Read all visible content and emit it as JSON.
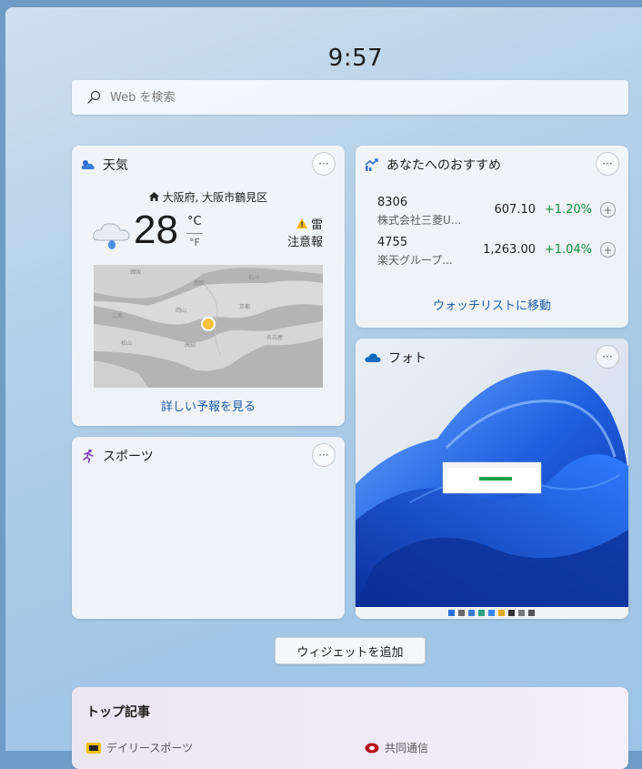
{
  "clock": {
    "time": "9:57"
  },
  "search": {
    "placeholder": "Web を検索",
    "icon": "search-icon"
  },
  "weather": {
    "title": "天気",
    "more": "···",
    "location": "大阪府, 大阪市鶴見区",
    "temperature": "28",
    "unit_c": "°C",
    "unit_f": "°F",
    "alert_line1": "雷",
    "alert_line2": "注意報",
    "forecast_link": "詳しい予報を見る",
    "condition_icon": "cloud-rain-icon"
  },
  "recommend": {
    "title": "あなたへのおすすめ",
    "more": "···",
    "stocks": [
      {
        "code": "8306",
        "name": "株式会社三菱U...",
        "price": "607.10",
        "change": "+1.20%"
      },
      {
        "code": "4755",
        "name": "楽天グループ...",
        "price": "1,263.00",
        "change": "+1.04%"
      }
    ],
    "watchlist_link": "ウォッチリストに移動",
    "positive_color": "#0f8a3c"
  },
  "sports": {
    "title": "スポーツ",
    "more": "···"
  },
  "photos": {
    "title": "フォト",
    "more": "···"
  },
  "add_widget": {
    "label": "ウィジェットを追加"
  },
  "top_stories": {
    "title": "トップ記事",
    "sources": [
      "デイリースポーツ",
      "共同通信"
    ]
  },
  "colors": {
    "link": "#1d5da8",
    "accent": "#0078d4"
  }
}
